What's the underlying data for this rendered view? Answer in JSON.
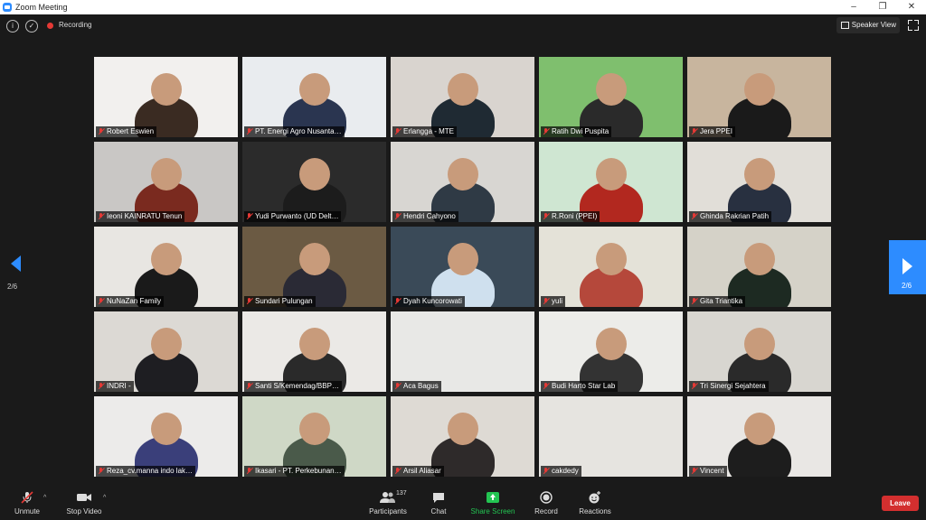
{
  "window": {
    "title": "Zoom Meeting",
    "controls": [
      "–",
      "❐",
      "✕"
    ]
  },
  "topbar": {
    "recording_label": "Recording",
    "view_label": "Speaker View",
    "info_icon": "info-icon",
    "shield_icon": "shield-icon"
  },
  "navigation": {
    "left_page": "2/6",
    "right_page": "2/6"
  },
  "participants": [
    {
      "name": "Robert Eswien",
      "bg": "#f2f0ee",
      "person": "#3a2b22"
    },
    {
      "name": "PT. Energi Agro Nusanta…",
      "bg": "#e9ecef",
      "person": "#2a3550"
    },
    {
      "name": "Erlangga - MTE",
      "bg": "#d9d4cf",
      "person": "#1f2a33"
    },
    {
      "name": "Ratih Dwi Puspita",
      "bg": "#7fbf6e",
      "person": "#2a2a2a"
    },
    {
      "name": "Jera PPEI",
      "bg": "#c8b59e",
      "person": "#1a1a1a"
    },
    {
      "name": "Ieoni KAINRATU Tenun",
      "bg": "#c9c7c5",
      "person": "#7a2a1f"
    },
    {
      "name": "Yudi Purwanto (UD Delt…",
      "bg": "#2b2b2b",
      "person": "#1c1c1c"
    },
    {
      "name": "Hendri Cahyono",
      "bg": "#d8d6d2",
      "person": "#2f3a45"
    },
    {
      "name": "R.Roni (PPEI)",
      "bg": "#cfe6d2",
      "person": "#b2281f"
    },
    {
      "name": "Ghinda Rakrian Patih",
      "bg": "#e1ded8",
      "person": "#283040"
    },
    {
      "name": "NuNaZan Family",
      "bg": "#e8e6e2",
      "person": "#1a1a1a"
    },
    {
      "name": "Sundari Pulungan",
      "bg": "#6b5a43",
      "person": "#2a2a35"
    },
    {
      "name": "Dyah Kuncorowati",
      "bg": "#3a4a58",
      "person": "#cfe0ee"
    },
    {
      "name": "yuli",
      "bg": "#e4e2d8",
      "person": "#b5483b"
    },
    {
      "name": "Gita Triantika",
      "bg": "#d5d2c8",
      "person": "#1d2a22"
    },
    {
      "name": "INDRI -",
      "bg": "#dcd9d4",
      "person": "#1e1e22"
    },
    {
      "name": "Santi S/Kemendag/BBP…",
      "bg": "#ebe9e6",
      "person": "#2a2a2a"
    },
    {
      "name": "Aca Bagus",
      "bg": "#e8e8e6",
      "person": "#e8e8e6"
    },
    {
      "name": "Budi Harto Star Lab",
      "bg": "#ecece9",
      "person": "#333"
    },
    {
      "name": "Tri Sinergi Sejahtera",
      "bg": "#d8d6d0",
      "person": "#2a2a2a"
    },
    {
      "name": "Reza_cv.manna indo lak…",
      "bg": "#ecebea",
      "person": "#3a3f7a"
    },
    {
      "name": "Ikasari - PT. Perkebunan…",
      "bg": "#cfd8c6",
      "person": "#4a5a4a"
    },
    {
      "name": "Arsil Aliasar",
      "bg": "#dedad4",
      "person": "#2e2a2a"
    },
    {
      "name": "cakdedy",
      "bg": "#e6e4e0",
      "person": "#e6e4e0"
    },
    {
      "name": "Vincent",
      "bg": "#e9e7e4",
      "person": "#1d1d1d"
    }
  ],
  "toolbar": {
    "unmute": "Unmute",
    "stop_video": "Stop Video",
    "participants": "Participants",
    "participants_count": "137",
    "chat": "Chat",
    "share_screen": "Share Screen",
    "record": "Record",
    "reactions": "Reactions",
    "leave": "Leave"
  },
  "colors": {
    "accent": "#2d8cff",
    "leave": "#d32f2f",
    "share": "#23c552",
    "muted": "#e53935"
  }
}
